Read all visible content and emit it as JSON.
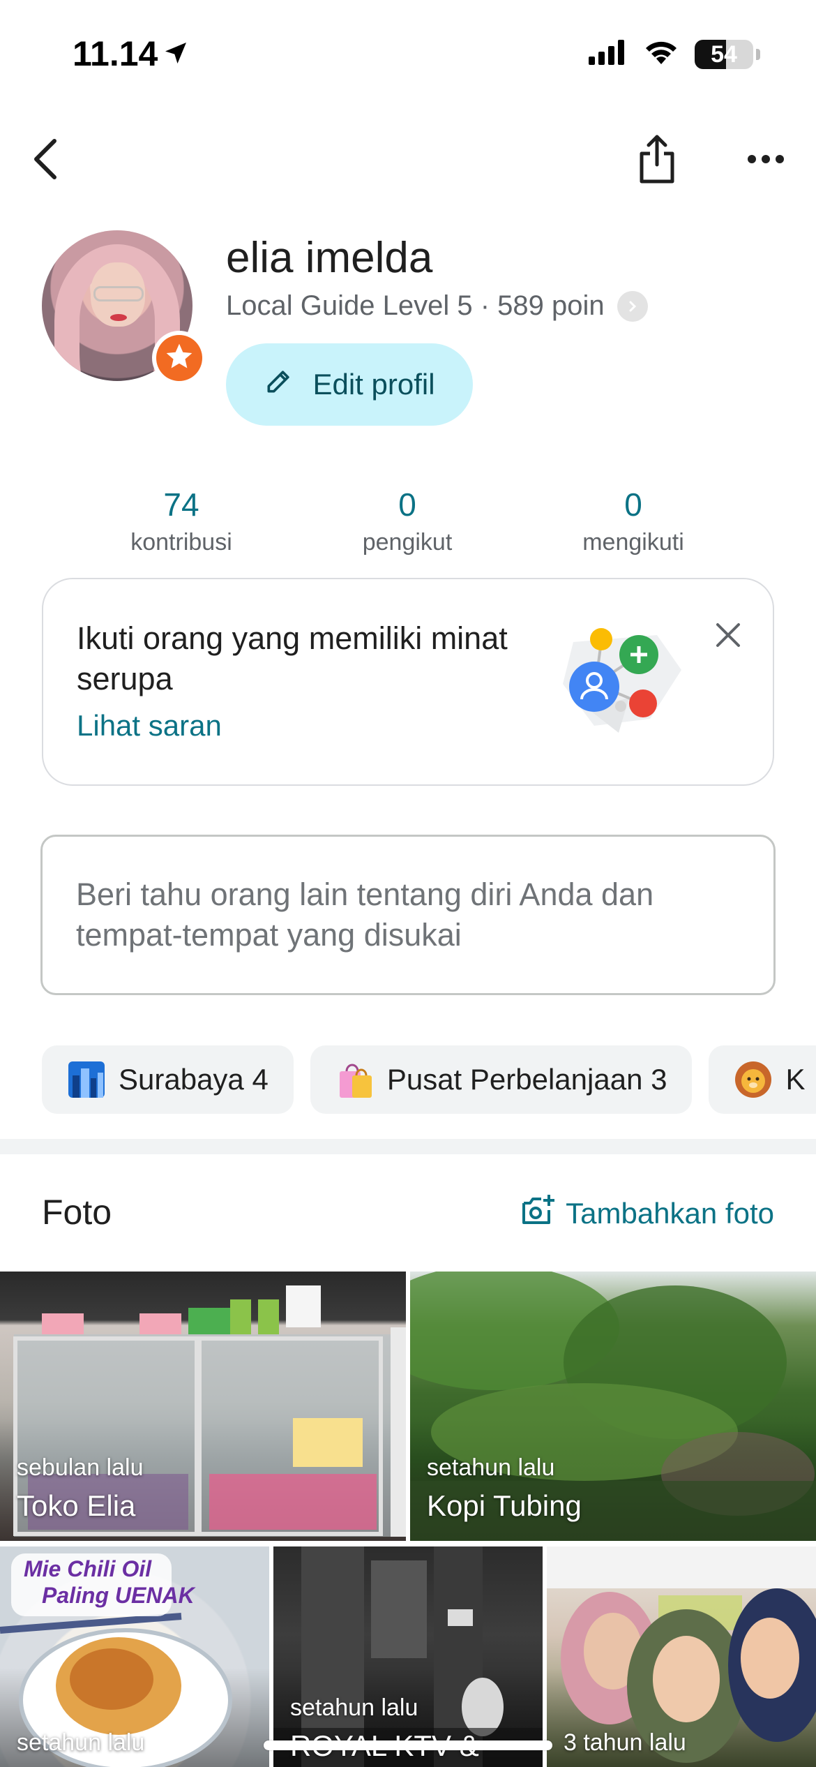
{
  "status_bar": {
    "time": "11.14",
    "battery": "54",
    "battery_level": 0.54
  },
  "profile": {
    "name": "elia imelda",
    "level_text": "Local Guide Level 5 · 589 poin",
    "edit_label": "Edit profil"
  },
  "stats": [
    {
      "value": "74",
      "label": "kontribusi"
    },
    {
      "value": "0",
      "label": "pengikut"
    },
    {
      "value": "0",
      "label": "mengikuti"
    }
  ],
  "suggestion": {
    "text": "Ikuti orang yang memiliki minat serupa",
    "link": "Lihat saran"
  },
  "bio": {
    "placeholder": "Beri tahu orang lain tentang diri Anda dan tempat-tempat yang disukai"
  },
  "chips": [
    {
      "label": "Surabaya 4",
      "icon": "cityscape-icon"
    },
    {
      "label": "Pusat Perbelanjaan 3",
      "icon": "shopping-bags-icon"
    },
    {
      "label": "K",
      "icon": "lion-icon"
    }
  ],
  "photos": {
    "title": "Foto",
    "add_label": "Tambahkan foto",
    "items": [
      {
        "time": "sebulan lalu",
        "name": "Toko Elia"
      },
      {
        "time": "setahun lalu",
        "name": "Kopi Tubing"
      },
      {
        "time": "setahun lalu",
        "name": ""
      },
      {
        "time": "setahun lalu",
        "name": "ROYAL KTV &"
      },
      {
        "time": "3 tahun lalu",
        "name": ""
      }
    ],
    "overlay_text_line1": "Mie Chili Oil",
    "overlay_text_line2": "Paling UENAK"
  },
  "colors": {
    "accent": "#0b7285",
    "edit_button_bg": "#c9f3fb",
    "badge": "#f26b22"
  }
}
